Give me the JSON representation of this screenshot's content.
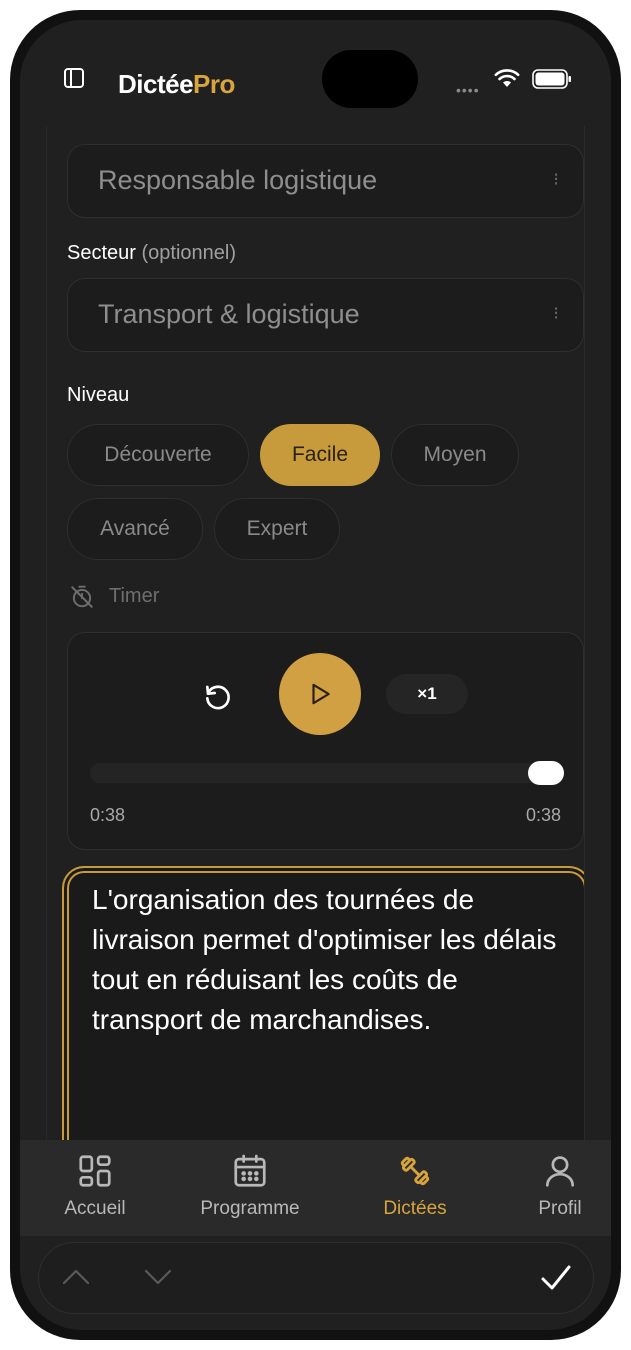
{
  "header": {
    "app_name_main": "Dictée",
    "app_name_accent": "Pro",
    "signal_text": "••••"
  },
  "form": {
    "job_field_value": "Responsable logistique",
    "sector_label": "Secteur",
    "sector_optional": "(optionnel)",
    "sector_field_value": "Transport & logistique",
    "level_label": "Niveau",
    "levels": [
      {
        "label": "Découverte"
      },
      {
        "label": "Facile"
      },
      {
        "label": "Moyen"
      },
      {
        "label": "Avancé"
      },
      {
        "label": "Expert"
      }
    ],
    "selected_level": "Facile",
    "timer_label": "Timer"
  },
  "player": {
    "speed_label": "×1",
    "current_time": "0:38",
    "total_time": "0:38",
    "progress_percent": 100
  },
  "dictation": {
    "text": "L'organisation des tournées de livraison permet d'optimiser les délais tout en réduisant les coûts de transport de marchandises."
  },
  "tabbar": {
    "tabs": [
      {
        "label": "Accueil",
        "icon": "grid-icon"
      },
      {
        "label": "Programme",
        "icon": "calendar-icon"
      },
      {
        "label": "Dictées",
        "icon": "dumbbell-icon"
      },
      {
        "label": "Profil",
        "icon": "user-icon"
      }
    ],
    "active": "Dictées"
  },
  "colors": {
    "accent": "#d1a043",
    "background": "#202020",
    "surface": "#1c1c1c"
  }
}
